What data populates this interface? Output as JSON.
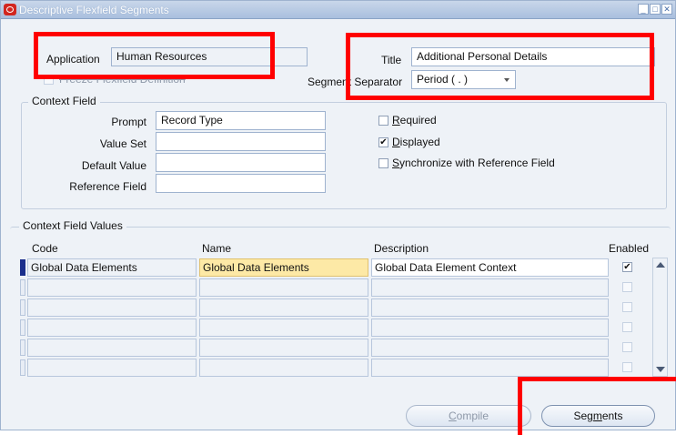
{
  "window": {
    "title": "Descriptive Flexfield Segments"
  },
  "header": {
    "application_label": "Application",
    "application_value": "Human Resources",
    "freeze_label": "Freeze Flexfield Definition",
    "title_label": "Title",
    "title_value": "Additional Personal Details",
    "separator_label": "Segment Separator",
    "separator_value": "Period ( . )"
  },
  "context_field": {
    "group_title": "Context Field",
    "prompt_label": "Prompt",
    "prompt_value": "Record Type",
    "value_set_label": "Value Set",
    "value_set_value": "",
    "default_value_label": "Default Value",
    "default_value_value": "",
    "reference_field_label": "Reference Field",
    "reference_field_value": "",
    "required": {
      "before": "",
      "mnemonic": "R",
      "after": "equired",
      "checked": false
    },
    "displayed": {
      "before": "",
      "mnemonic": "D",
      "after": "isplayed",
      "checked": true
    },
    "synchronize": {
      "before": "",
      "mnemonic": "S",
      "after": "ynchronize with Reference Field",
      "checked": false
    }
  },
  "context_values": {
    "group_title": "Context Field Values",
    "columns": {
      "code": "Code",
      "name": "Name",
      "description": "Description",
      "enabled": "Enabled"
    },
    "rows": [
      {
        "code": "Global Data Elements",
        "name": "Global Data Elements",
        "description": "Global Data Element Context",
        "enabled": true
      },
      {
        "code": "",
        "name": "",
        "description": "",
        "enabled": false
      },
      {
        "code": "",
        "name": "",
        "description": "",
        "enabled": false
      },
      {
        "code": "",
        "name": "",
        "description": "",
        "enabled": false
      },
      {
        "code": "",
        "name": "",
        "description": "",
        "enabled": false
      },
      {
        "code": "",
        "name": "",
        "description": "",
        "enabled": false
      }
    ]
  },
  "buttons": {
    "compile": {
      "before": "",
      "mnemonic": "C",
      "after": "ompile"
    },
    "segments": {
      "before": "Seg",
      "mnemonic": "m",
      "after": "ents"
    }
  },
  "icons": {
    "app": "oracle-app-icon",
    "minimize": "minimize-icon",
    "maximize": "maximize-icon",
    "close": "close-icon"
  },
  "colors": {
    "annotation": "#ff0000",
    "active_row": "#1b2f8c",
    "selected_cell": "#fde9a6"
  }
}
